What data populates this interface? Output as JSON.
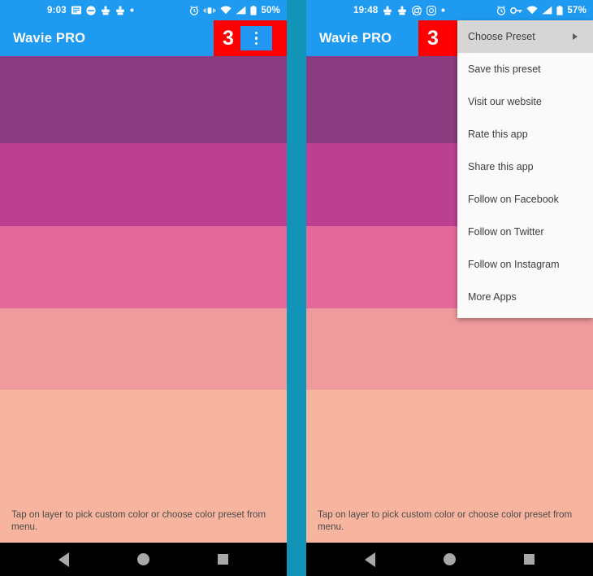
{
  "divider_color": "#1293b8",
  "accent": {
    "appbar_blue": "#1e9af0",
    "annotation_red": "#ff0000",
    "highlight_blue": "#2196f3"
  },
  "panels": [
    {
      "id": "left",
      "statusbar": {
        "clock": "9:03",
        "battery_pct": "50%",
        "left_icons": [
          "message-icon",
          "contactless-icon",
          "brush-icon",
          "brush-icon",
          "dot-icon"
        ],
        "right_icons": [
          "alarm-icon",
          "vibrate-icon",
          "wifi-icon",
          "signal-icon",
          "battery-icon"
        ]
      },
      "appbar": {
        "title": "Wavie PRO",
        "step_number": "3",
        "overflow_icon": "overflow-menu-icon"
      },
      "layers": [
        {
          "name": "layer-1",
          "color": "#8a3c80",
          "height": 107
        },
        {
          "name": "layer-2",
          "color": "#bb4091",
          "height": 102
        },
        {
          "name": "layer-3",
          "color": "#e4699a",
          "height": 101
        },
        {
          "name": "layer-4",
          "color": "#ef9a9c",
          "height": 100
        },
        {
          "name": "layer-5",
          "color": "#f7b49e",
          "height": 188
        }
      ],
      "hint": "Tap on layer to pick custom color or choose color preset from menu.",
      "navbar": [
        "back-icon",
        "home-icon",
        "recents-icon"
      ],
      "menu_open": false
    },
    {
      "id": "right",
      "statusbar": {
        "clock": "19:48",
        "battery_pct": "57%",
        "left_icons": [
          "brush-icon",
          "brush-icon",
          "chrome-icon",
          "instagram-icon",
          "dot-icon"
        ],
        "right_icons": [
          "alarm-icon",
          "vpn-key-icon",
          "wifi-icon",
          "signal-icon",
          "battery-icon"
        ]
      },
      "appbar": {
        "title": "Wavie PRO",
        "step_number": "3",
        "overflow_icon": "overflow-menu-icon"
      },
      "layers": [
        {
          "name": "layer-1",
          "color": "#8a3c80",
          "height": 107
        },
        {
          "name": "layer-2",
          "color": "#bb4091",
          "height": 102
        },
        {
          "name": "layer-3",
          "color": "#e4699a",
          "height": 101
        },
        {
          "name": "layer-4",
          "color": "#ef9a9c",
          "height": 100
        },
        {
          "name": "layer-5",
          "color": "#f7b49e",
          "height": 188
        }
      ],
      "hint": "Tap on layer to pick custom color or choose color preset from menu.",
      "navbar": [
        "back-icon",
        "home-icon",
        "recents-icon"
      ],
      "menu_open": true,
      "menu": {
        "items": [
          {
            "label": "Choose Preset",
            "has_submenu": true,
            "highlighted": true
          },
          {
            "label": "Save this preset",
            "has_submenu": false,
            "highlighted": false
          },
          {
            "label": "Visit our website",
            "has_submenu": false,
            "highlighted": false
          },
          {
            "label": "Rate this app",
            "has_submenu": false,
            "highlighted": false
          },
          {
            "label": "Share this app",
            "has_submenu": false,
            "highlighted": false
          },
          {
            "label": "Follow on Facebook",
            "has_submenu": false,
            "highlighted": false
          },
          {
            "label": "Follow on Twitter",
            "has_submenu": false,
            "highlighted": false
          },
          {
            "label": "Follow on Instagram",
            "has_submenu": false,
            "highlighted": false
          },
          {
            "label": "More Apps",
            "has_submenu": false,
            "highlighted": false
          }
        ]
      }
    }
  ]
}
